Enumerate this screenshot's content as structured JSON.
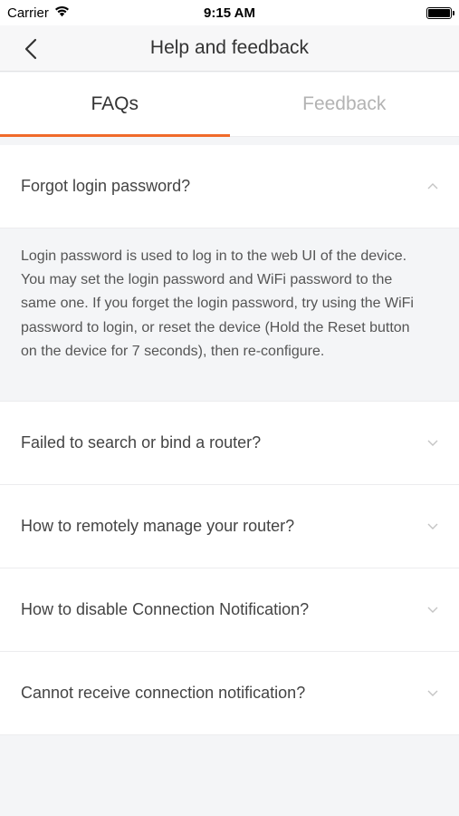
{
  "status_bar": {
    "carrier": "Carrier",
    "time": "9:15 AM"
  },
  "nav": {
    "title": "Help and feedback"
  },
  "tabs": [
    {
      "label": "FAQs",
      "active": true
    },
    {
      "label": "Feedback",
      "active": false
    }
  ],
  "accent_color": "#f06a2a",
  "faqs": [
    {
      "question": "Forgot login password?",
      "expanded": true,
      "answer": "Login password is used to log in to the web UI of the device. You may set the login password and WiFi password to the same one. If you forget the login password, try using the WiFi password to login, or reset the device (Hold the Reset button on the device for 7 seconds), then re-configure."
    },
    {
      "question": "Failed to search or bind a router?",
      "expanded": false
    },
    {
      "question": "How to remotely manage your router?",
      "expanded": false
    },
    {
      "question": "How to disable Connection Notification?",
      "expanded": false
    },
    {
      "question": "Cannot receive connection notification?",
      "expanded": false
    }
  ]
}
